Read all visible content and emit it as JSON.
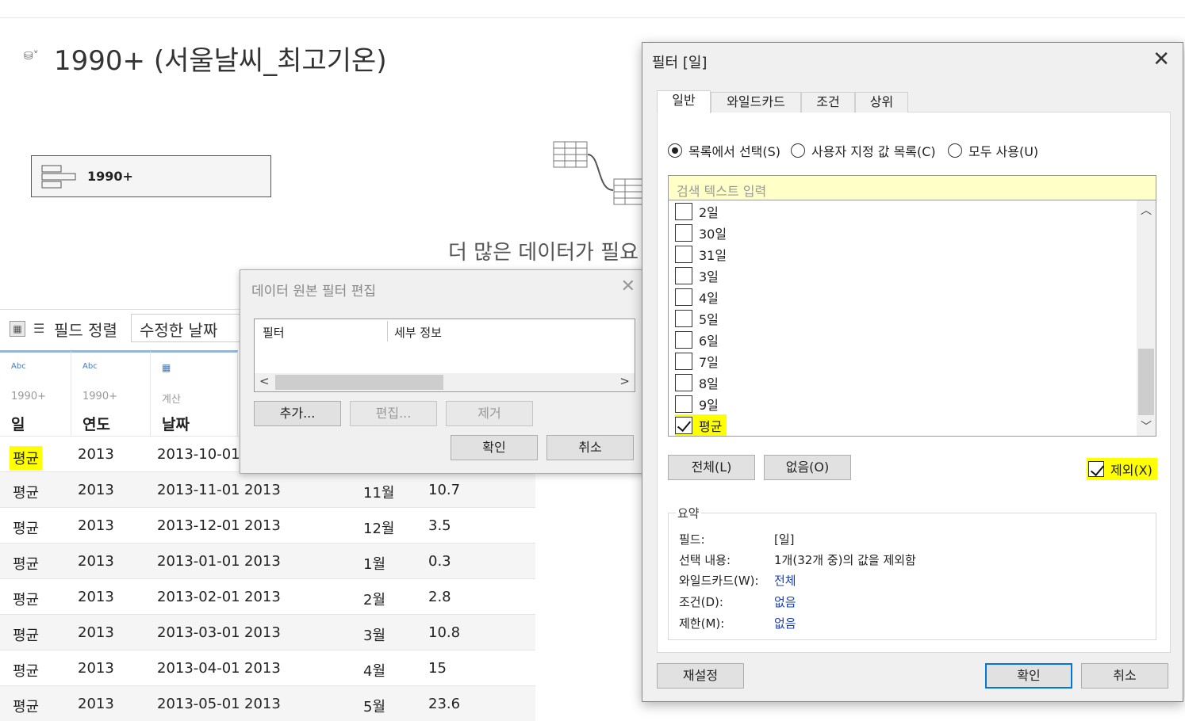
{
  "background": {
    "title": "1990+ (서울날씨_최고기온)",
    "table_card_label": "1990+",
    "more_data_text": "더 많은 데이터가 필요",
    "toolbar": {
      "sort_label": "필드 정렬",
      "sort_value": "수정한 날짜"
    },
    "columns": [
      {
        "type": "Abc",
        "source": "1990+",
        "name": "일"
      },
      {
        "type": "Abc",
        "source": "1990+",
        "name": "연도"
      },
      {
        "type": "calendar-icon",
        "source": "계산",
        "name": "날짜"
      }
    ],
    "rows": [
      {
        "c1": "평균",
        "c2": "2013",
        "c3": "2013-10-01",
        "c4": "",
        "c5": "",
        "c6": ""
      },
      {
        "c1": "평균",
        "c2": "2013",
        "c3": "2013-11-01",
        "c4": "2013",
        "c5": "11월",
        "c6": "10.7"
      },
      {
        "c1": "평균",
        "c2": "2013",
        "c3": "2013-12-01",
        "c4": "2013",
        "c5": "12월",
        "c6": "3.5"
      },
      {
        "c1": "평균",
        "c2": "2013",
        "c3": "2013-01-01",
        "c4": "2013",
        "c5": "1월",
        "c6": "0.3"
      },
      {
        "c1": "평균",
        "c2": "2013",
        "c3": "2013-02-01",
        "c4": "2013",
        "c5": "2월",
        "c6": "2.8"
      },
      {
        "c1": "평균",
        "c2": "2013",
        "c3": "2013-03-01",
        "c4": "2013",
        "c5": "3월",
        "c6": "10.8"
      },
      {
        "c1": "평균",
        "c2": "2013",
        "c3": "2013-04-01",
        "c4": "2013",
        "c5": "4월",
        "c6": "15"
      },
      {
        "c1": "평균",
        "c2": "2013",
        "c3": "2013-05-01",
        "c4": "2013",
        "c5": "5월",
        "c6": "23.6"
      }
    ]
  },
  "ds_filter_dialog": {
    "title": "데이터 원본 필터 편집",
    "col_filter": "필터",
    "col_details": "세부 정보",
    "add": "추가...",
    "edit": "편집...",
    "remove": "제거",
    "ok": "확인",
    "cancel": "취소"
  },
  "filter_dialog": {
    "title": "필터 [일]",
    "tabs": [
      "일반",
      "와일드카드",
      "조건",
      "상위"
    ],
    "radios": [
      "목록에서 선택(S)",
      "사용자 지정 값 목록(C)",
      "모두 사용(U)"
    ],
    "search_placeholder": "검색 텍스트 입력",
    "items": [
      "2일",
      "30일",
      "31일",
      "3일",
      "4일",
      "5일",
      "6일",
      "7일",
      "8일",
      "9일",
      "평균"
    ],
    "btn_all": "전체(L)",
    "btn_none": "없음(O)",
    "exclude": "제외(X)",
    "summary": {
      "title": "요약",
      "field_label": "필드:",
      "field_value": "[일]",
      "selection_label": "선택 내용:",
      "selection_value": "1개(32개 중)의 값을 제외함",
      "wildcard_label": "와일드카드(W):",
      "wildcard_value": "전체",
      "condition_label": "조건(D):",
      "condition_value": "없음",
      "limit_label": "제한(M):",
      "limit_value": "없음"
    },
    "btn_reset": "재설정",
    "btn_ok": "확인",
    "btn_cancel": "취소"
  },
  "colors": {
    "highlight": "#ffff00",
    "accent": "#0078d7",
    "link": "#1a3fb4"
  }
}
